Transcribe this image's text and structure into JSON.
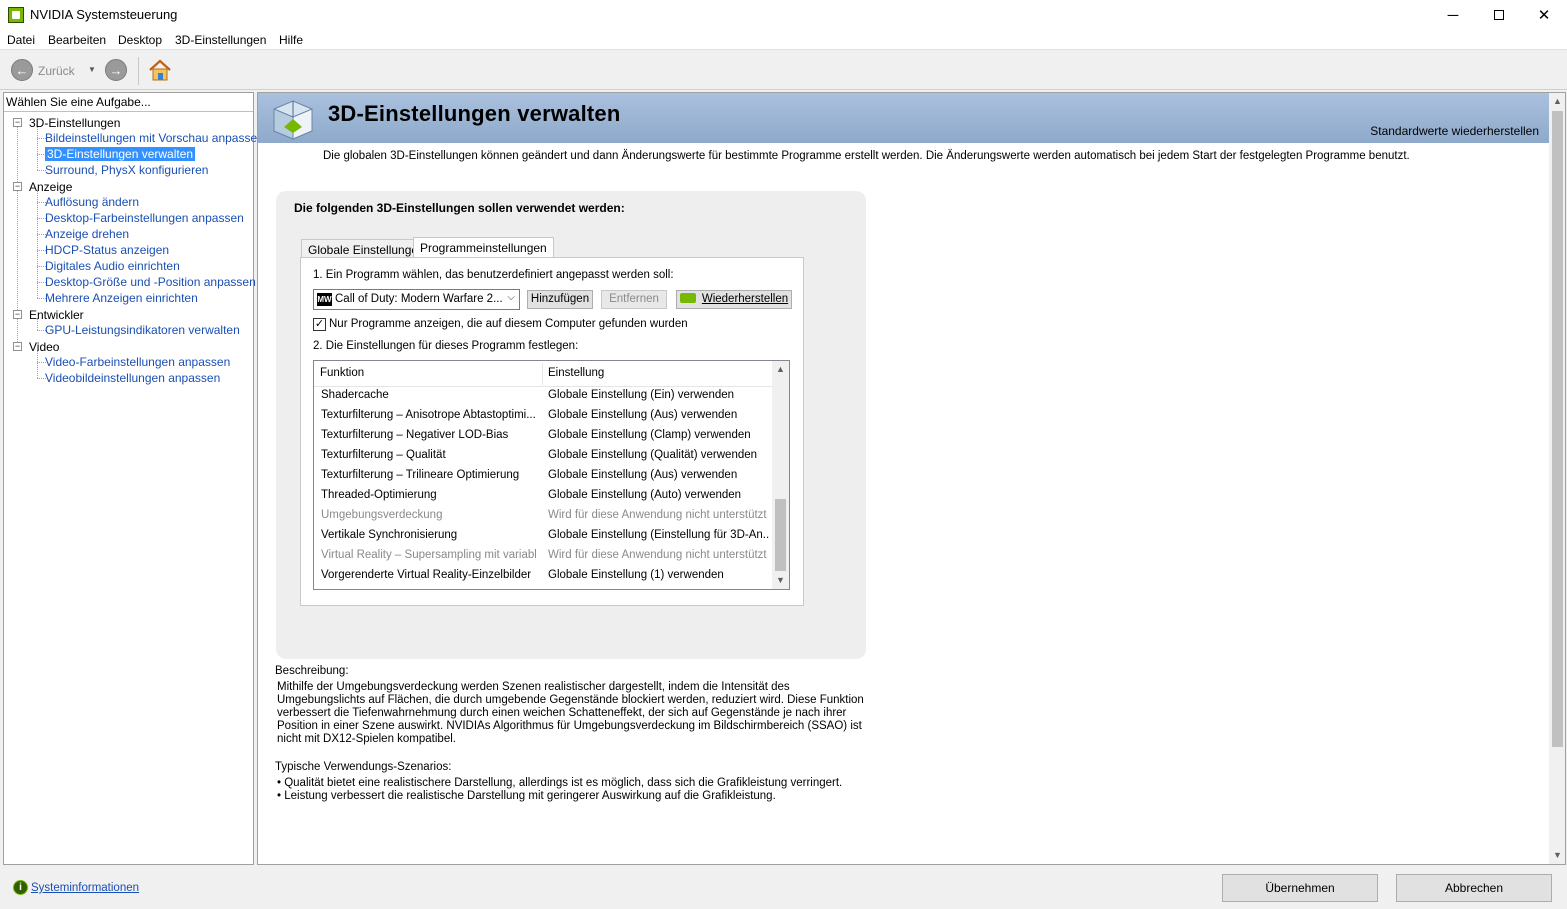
{
  "window": {
    "title": "NVIDIA Systemsteuerung",
    "minimize": "─",
    "close": "✕"
  },
  "menu": [
    "Datei",
    "Bearbeiten",
    "Desktop",
    "3D-Einstellungen",
    "Hilfe"
  ],
  "toolbar": {
    "back_label": "Zurück",
    "back_glyph": "←",
    "forward_glyph": "→",
    "dropdown_glyph": "▼"
  },
  "sidebar": {
    "task_label": "Wählen Sie eine Aufgabe...",
    "expander": "−",
    "categories": [
      {
        "label": "3D-Einstellungen",
        "items": [
          "Bildeinstellungen mit Vorschau anpassen",
          "3D-Einstellungen verwalten",
          "Surround, PhysX konfigurieren"
        ]
      },
      {
        "label": "Anzeige",
        "items": [
          "Auflösung ändern",
          "Desktop-Farbeinstellungen anpassen",
          "Anzeige drehen",
          "HDCP-Status anzeigen",
          "Digitales Audio einrichten",
          "Desktop-Größe und -Position anpassen",
          "Mehrere Anzeigen einrichten"
        ]
      },
      {
        "label": "Entwickler",
        "items": [
          "GPU-Leistungsindikatoren verwalten"
        ]
      },
      {
        "label": "Video",
        "items": [
          "Video-Farbeinstellungen anpassen",
          "Videobildeinstellungen anpassen"
        ]
      }
    ],
    "selected": "3D-Einstellungen verwalten"
  },
  "page": {
    "title": "3D-Einstellungen verwalten",
    "restore_defaults": "Standardwerte wiederherstellen",
    "intro": "Die globalen 3D-Einstellungen können geändert und dann Änderungswerte für bestimmte Programme erstellt werden. Die Änderungswerte werden automatisch bei jedem Start der festgelegten Programme benutzt.",
    "box_heading": "Die folgenden 3D-Einstellungen sollen verwendet werden:",
    "tabs": [
      "Globale Einstellungen",
      "Programmeinstellungen"
    ],
    "active_tab": "Programmeinstellungen",
    "step1": "1. Ein Programm wählen, das benutzerdefiniert angepasst werden soll:",
    "program_icon": "MW",
    "program_selected": "Call of Duty: Modern Warfare 2...",
    "select_arrow": "⌵",
    "buttons": {
      "add": "Hinzufügen",
      "remove": "Entfernen",
      "restore": "Wiederherstellen"
    },
    "checkbox_label": "Nur Programme anzeigen, die auf diesem Computer gefunden wurden",
    "checkbox_checked": true,
    "checkbox_mark": "✓",
    "step2": "2. Die Einstellungen für dieses Programm festlegen:",
    "columns": [
      "Funktion",
      "Einstellung"
    ],
    "list_up": "▲",
    "list_down": "▼",
    "rows": [
      {
        "f": "Shadercache",
        "e": "Globale Einstellung (Ein) verwenden",
        "dim": false
      },
      {
        "f": "Texturfilterung – Anisotrope Abtastoptimi...",
        "e": "Globale Einstellung (Aus) verwenden",
        "dim": false
      },
      {
        "f": "Texturfilterung – Negativer LOD-Bias",
        "e": "Globale Einstellung (Clamp) verwenden",
        "dim": false
      },
      {
        "f": "Texturfilterung – Qualität",
        "e": "Globale Einstellung (Qualität) verwenden",
        "dim": false
      },
      {
        "f": "Texturfilterung – Trilineare Optimierung",
        "e": "Globale Einstellung (Aus) verwenden",
        "dim": false
      },
      {
        "f": "Threaded-Optimierung",
        "e": "Globale Einstellung (Auto) verwenden",
        "dim": false
      },
      {
        "f": "Umgebungsverdeckung",
        "e": "Wird für diese Anwendung nicht unterstützt",
        "dim": true
      },
      {
        "f": "Vertikale Synchronisierung",
        "e": "Globale Einstellung (Einstellung für 3D-An...",
        "dim": false
      },
      {
        "f": "Virtual Reality – Supersampling mit variabl...",
        "e": "Wird für diese Anwendung nicht unterstützt",
        "dim": true
      },
      {
        "f": "Vorgerenderte Virtual Reality-Einzelbilder",
        "e": "Globale Einstellung (1) verwenden",
        "dim": false
      }
    ],
    "description_label": "Beschreibung:",
    "description": "Mithilfe der Umgebungsverdeckung werden Szenen realistischer dargestellt, indem die Intensität des Umgebungslichts auf Flächen, die durch umgebende Gegenstände blockiert werden, reduziert wird. Diese Funktion verbessert die Tiefenwahrnehmung durch einen weichen Schatteneffekt, der sich auf Gegenstände je nach ihrer Position in einer Szene auswirkt. NVIDIAs Algorithmus für Umgebungsverdeckung im Bildschirmbereich (SSAO) ist nicht mit DX12-Spielen kompatibel.",
    "usage_label": "Typische Verwendungs-Szenarios:",
    "usage": [
      "• Qualität bietet eine realistischere Darstellung, allerdings ist es möglich, dass sich die Grafikleistung verringert.",
      "• Leistung verbessert die realistische Darstellung mit geringerer Auswirkung auf die Grafikleistung."
    ]
  },
  "footer": {
    "sysinfo": "Systeminformationen",
    "sysinfo_glyph": "i",
    "apply": "Übernehmen",
    "cancel": "Abbrechen"
  },
  "colors": {
    "link": "#1a4fb5",
    "selection": "#3390ff",
    "banner": "#a9c1dd",
    "nvidia_green": "#76b900"
  }
}
